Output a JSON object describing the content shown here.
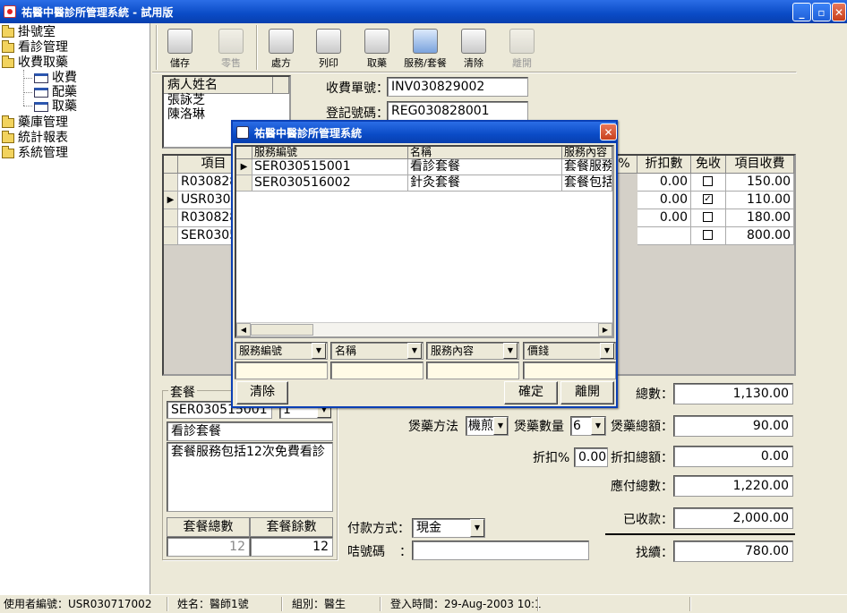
{
  "window": {
    "title": "祐醫中醫診所管理系統 - 試用版"
  },
  "tree": {
    "top": [
      {
        "label": "掛號室"
      },
      {
        "label": "看診管理"
      },
      {
        "label": "收費取藥"
      },
      {
        "label": "藥庫管理"
      },
      {
        "label": "統計報表"
      },
      {
        "label": "系統管理"
      }
    ],
    "children": [
      {
        "label": "收費"
      },
      {
        "label": "配藥"
      },
      {
        "label": "取藥"
      }
    ]
  },
  "toolbar": {
    "buttons": [
      {
        "label": "儲存",
        "icon": "save-icon",
        "enabled": true
      },
      {
        "label": "零售",
        "icon": "retail-icon",
        "enabled": false
      },
      {
        "label": "處方",
        "icon": "prescription-icon",
        "enabled": true
      },
      {
        "label": "列印",
        "icon": "printer-icon",
        "enabled": true
      },
      {
        "label": "取藥",
        "icon": "pickup-icon",
        "enabled": true
      },
      {
        "label": "服務/套餐",
        "icon": "service-package-icon",
        "enabled": true
      },
      {
        "label": "清除",
        "icon": "clear-icon",
        "enabled": true
      },
      {
        "label": "離開",
        "icon": "exit-door-icon",
        "enabled": false
      }
    ]
  },
  "patients": {
    "header": "病人姓名",
    "names": [
      "張詠芝",
      "陳洛琳"
    ]
  },
  "invoice": {
    "receipt_label": "收費單號：",
    "receipt_value": "INV030829002",
    "reg_label": "登記號碼：",
    "reg_value": "REG030828001"
  },
  "items_table": {
    "headers": [
      "項目",
      "%",
      "折扣數",
      "免收",
      "項目收費"
    ],
    "rows": [
      {
        "code": "R030828",
        "discount": "0.00",
        "free": false,
        "fee": "150.00"
      },
      {
        "code": "USR0307",
        "discount": "0.00",
        "free": true,
        "fee": "110.00"
      },
      {
        "code": "R030828",
        "discount": "0.00",
        "free": false,
        "fee": "180.00"
      },
      {
        "code": "SER0305",
        "discount": "",
        "free": false,
        "fee": "800.00"
      }
    ]
  },
  "package": {
    "group_label": "套餐",
    "code": "SER030515001",
    "qty": "1",
    "name": "看診套餐",
    "description": "套餐服務包括12次免費看診",
    "total_label": "套餐總數",
    "remaining_label": "套餐餘數",
    "total_value": "12",
    "remaining_value": "12"
  },
  "summary": {
    "total_count_label": "總數：",
    "total_count": "1,130.00",
    "decoct_method_label": "煲藥方法",
    "decoct_method": "機煎",
    "decoct_qty_label": "煲藥數量",
    "decoct_qty": "6",
    "decoct_amount_label": "煲藥總額：",
    "decoct_amount": "90.00",
    "discount_pct_label": "折扣%",
    "discount_pct": "0.00",
    "discount_total_label": "折扣總額：",
    "discount_total": "0.00",
    "payable_label": "應付總數：",
    "payable": "1,220.00",
    "received_label": "已收款：",
    "received": "2,000.00",
    "payment_label": "付款方式：",
    "payment_method": "現金",
    "chit_label": "咭號碼",
    "chit_colon": "：",
    "chit_value": "",
    "change_label": "找續：",
    "change": "780.00"
  },
  "dialog": {
    "title": "祐醫中醫診所管理系統",
    "headers": [
      "服務編號",
      "名稱",
      "服務內容"
    ],
    "rows": [
      {
        "code": "SER030515001",
        "name": "看診套餐",
        "content": "套餐服務"
      },
      {
        "code": "SER030516002",
        "name": "針灸套餐",
        "content": "套餐包括"
      }
    ],
    "filters": [
      "服務編號",
      "名稱",
      "服務內容",
      "價錢"
    ],
    "clear_label": "清除",
    "ok_label": "確定",
    "exit_label": "離開"
  },
  "status": {
    "user": "使用者編號：USR030717002",
    "name": "姓名：醫師1號",
    "group": "組別：醫生",
    "login": "登入時間：29-Aug-2003 10:1"
  }
}
